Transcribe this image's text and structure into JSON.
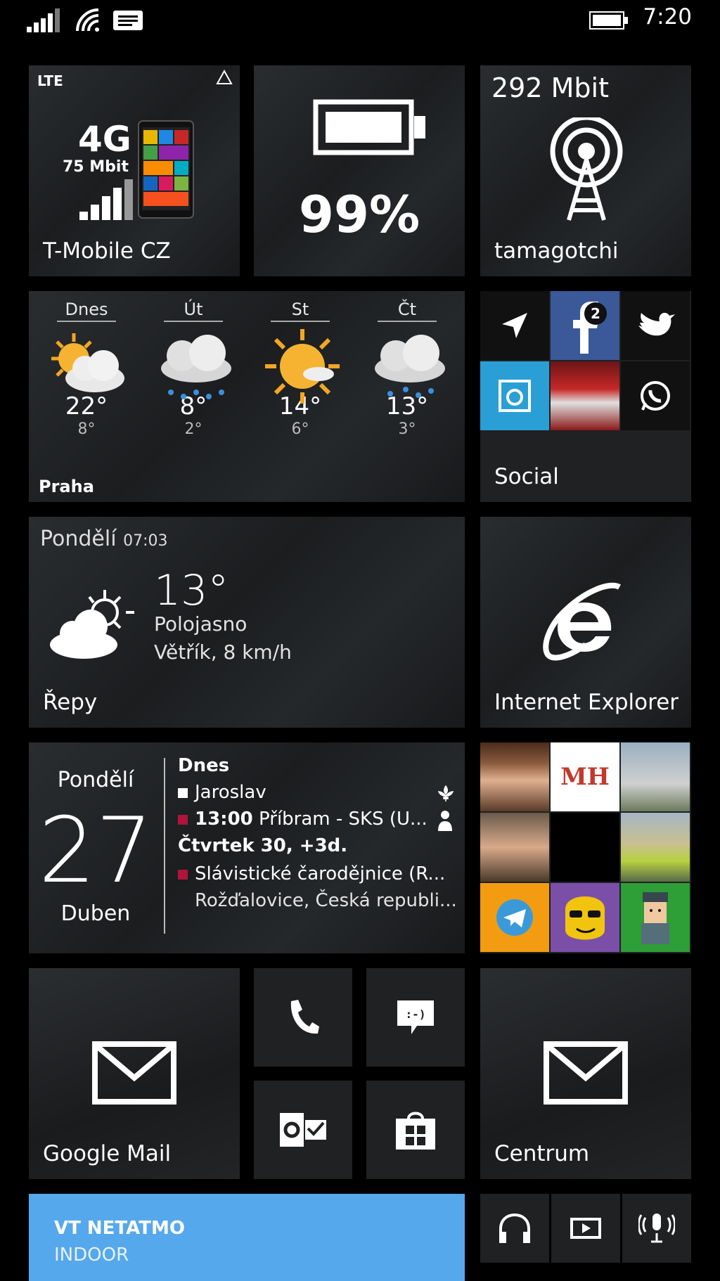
{
  "status_bar": {
    "clock": "7:20",
    "icons": [
      "signal-bars-icon",
      "wifi-icon",
      "message-icon",
      "battery-icon"
    ]
  },
  "tiles": {
    "network": {
      "badge": "LTE",
      "generation": "4G",
      "speed": "75 Mbit",
      "label": "T-Mobile CZ",
      "warning_icon": "warning-triangle-icon"
    },
    "battery": {
      "percent": "99%",
      "icon": "battery-full-icon"
    },
    "wifi": {
      "speed": "292 Mbit",
      "label": "tamagotchi",
      "icon": "radio-tower-icon"
    },
    "forecast": {
      "city": "Praha",
      "days": [
        {
          "day": "Dnes",
          "high": "22°",
          "low": "8°",
          "icon": "partly-cloudy-icon"
        },
        {
          "day": "Út",
          "high": "8°",
          "low": "2°",
          "icon": "rain-icon"
        },
        {
          "day": "St",
          "high": "14°",
          "low": "6°",
          "icon": "sunny-icon"
        },
        {
          "day": "Čt",
          "high": "13°",
          "low": "3°",
          "icon": "rain-icon"
        }
      ]
    },
    "social": {
      "label": "Social",
      "facebook_badge": "2"
    },
    "weather_today": {
      "day": "Pondělí",
      "time": "07:03",
      "temperature": "13°",
      "condition": "Polojasno",
      "wind": "Větřík, 8 km/h",
      "location": "Řepy"
    },
    "internet_explorer": {
      "label": "Internet Explorer"
    },
    "calendar": {
      "day_name": "Pondělí",
      "date": "27",
      "month": "Duben",
      "today_heading": "Dnes",
      "event1": "Jaroslav",
      "event2_time": "13:00",
      "event2_title": "Příbram - SKS (U...",
      "upcoming_heading": "Čtvrtek 30, +3d.",
      "event3_title": "Slávistické čarodějnice (R...",
      "event3_location": "Rožďalovice, Česká republi...",
      "colors": {
        "personal": "#ffffff",
        "event": "#b0143c"
      }
    },
    "google_mail": {
      "label": "Google Mail"
    },
    "centrum": {
      "label": "Centrum"
    },
    "netatmo": {
      "title": "VT NETATMO",
      "subtitle": "INDOOR",
      "color": "#56a8ec"
    },
    "phone": {
      "icon": "phone-icon"
    },
    "messaging": {
      "icon": "message-smiley-icon"
    },
    "outlook": {
      "icon": "outlook-icon"
    },
    "store": {
      "icon": "store-icon"
    },
    "small_apps": {
      "icons": [
        "headphones-icon",
        "video-icon",
        "microphone-icon"
      ]
    }
  }
}
